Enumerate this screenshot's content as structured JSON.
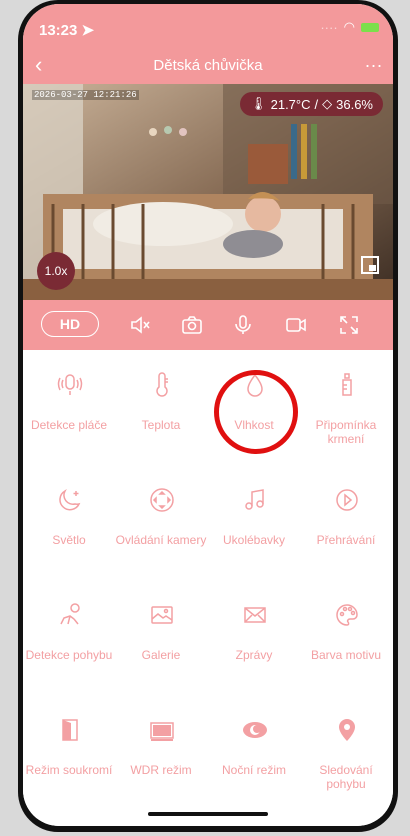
{
  "status": {
    "time": "13:23"
  },
  "nav": {
    "title": "Dětská chůvička",
    "more": "..."
  },
  "video": {
    "timestamp": "2026-03-27 12:21:26",
    "temperature": "21.7°C",
    "separator": "/",
    "humidity": "36.6%",
    "zoom": "1.0x"
  },
  "controls": {
    "hd": "HD"
  },
  "features": [
    "Detekce pláče",
    "Teplota",
    "Vlhkost",
    "Připomínka krmení",
    "Světlo",
    "Ovládání kamery",
    "Ukolébavky",
    "Přehrávání",
    "Detekce pohybu",
    "Galerie",
    "Zprávy",
    "Barva motivu",
    "Režim soukromí",
    "WDR režim",
    "Noční režim",
    "Sledování pohybu"
  ],
  "colors": {
    "accent": "#f3999b",
    "icon": "#f3a0a3",
    "badge": "#7a2a34",
    "highlight": "#e01010"
  }
}
